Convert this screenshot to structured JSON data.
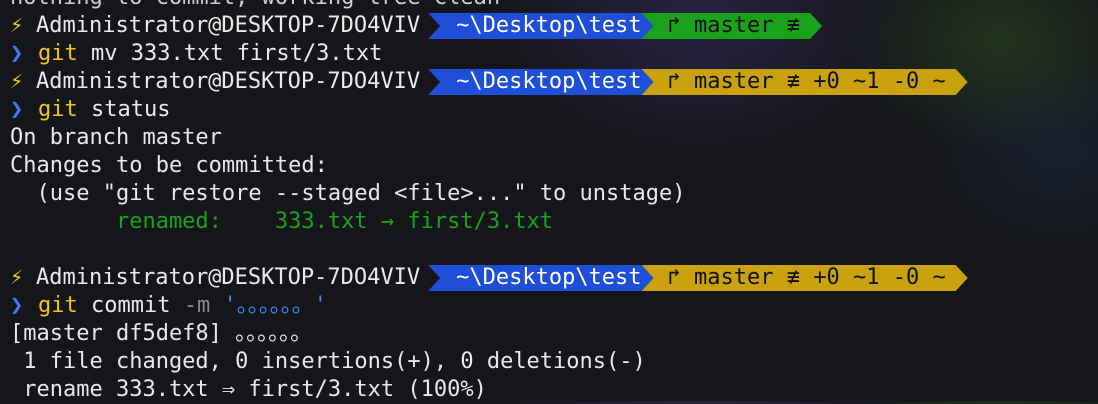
{
  "terminal": {
    "top_partial_line": "nothing to commit, working tree clean",
    "prompt_user": "Administrator@DESKTOP-7DO4VIV",
    "prompt_path": "~\\Desktop\\test",
    "git_clean": "↱ master ≢",
    "git_dirty": "↱ master ≢ +0 ~1 -0 ~",
    "chevron": "❯",
    "bolt": "⚡",
    "colors": {
      "path_bg": "#1f4fd8",
      "git_clean_bg": "#1aa31a",
      "git_dirty_bg": "#c9a10c",
      "accent_green": "#18a318"
    },
    "cmd1": {
      "cmd": "git",
      "args": " mv 333.txt first/3.txt"
    },
    "cmd2": {
      "cmd": "git",
      "args": " status"
    },
    "status_lines": [
      "On branch master",
      "Changes to be committed:",
      "  (use \"git restore --staged <file>...\" to unstage)"
    ],
    "renamed_label": "        renamed:    ",
    "renamed_value": "333.txt → first/3.txt",
    "cmd3": {
      "cmd": "git",
      "args": " commit ",
      "flag": "-m",
      "message": " '。。。。。。'"
    },
    "commit_lines": [
      "[master df5def8] 。。。。。。",
      " 1 file changed, 0 insertions(+), 0 deletions(-)",
      " rename 333.txt ⇒ first/3.txt (100%)"
    ]
  }
}
